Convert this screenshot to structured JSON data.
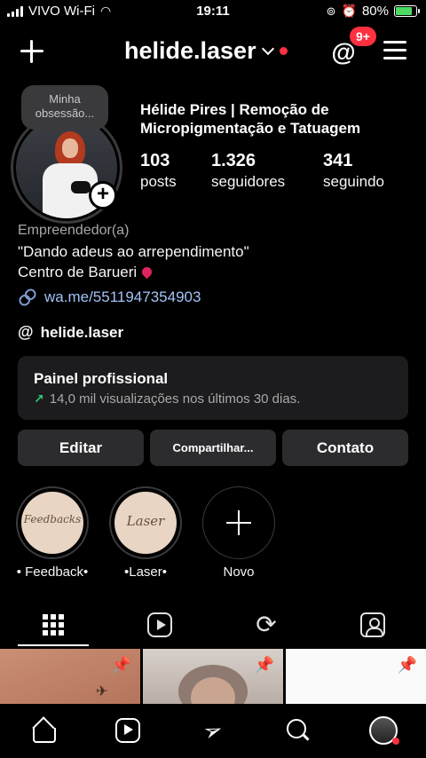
{
  "status_bar": {
    "carrier": "VIVO Wi-Fi",
    "time": "19:11",
    "battery": "80%",
    "battery_level": 0.8
  },
  "header": {
    "username": "helide.laser",
    "notification_badge": "9+"
  },
  "profile": {
    "note": "Minha obsessão...",
    "full_name": "Hélide Pires | Remoção de Micropigmentação e Tatuagem",
    "stats": [
      {
        "number": "103",
        "label": "posts"
      },
      {
        "number": "1.326",
        "label": "seguidores"
      },
      {
        "number": "341",
        "label": "seguindo"
      }
    ],
    "category": "Empreendedor(a)",
    "bio_line1": "\"Dando adeus ao arrependimento\"",
    "bio_line2": "Centro de Barueri",
    "link": "wa.me/5511947354903",
    "threads_handle": "helide.laser"
  },
  "pro_panel": {
    "title": "Painel profissional",
    "subtitle": "14,0 mil visualizações nos últimos 30 dias."
  },
  "buttons": {
    "edit": "Editar",
    "share": "Compartilhar...",
    "contact": "Contato"
  },
  "highlights": [
    {
      "label": "• Feedback•",
      "cover_text": "Feedbacks"
    },
    {
      "label": "•Laser•",
      "cover_text": "Laser"
    },
    {
      "label": "Novo"
    }
  ],
  "colors": {
    "background": "#000000",
    "card": "#1c1c1e",
    "button": "#2c2c2e",
    "accent_red": "#ff3040",
    "link": "#a3c2f5"
  }
}
